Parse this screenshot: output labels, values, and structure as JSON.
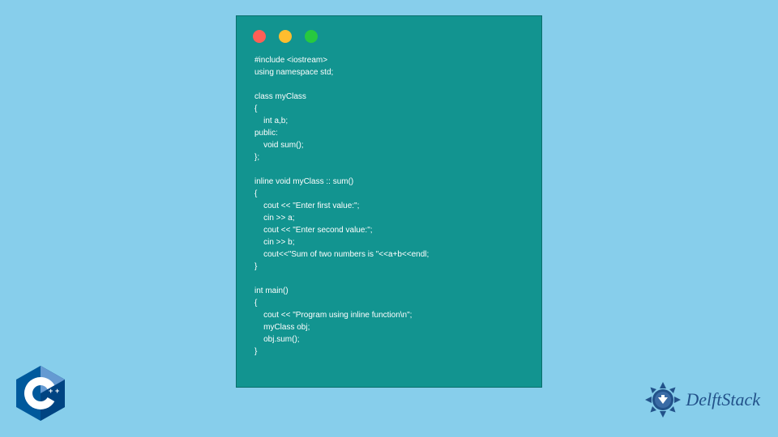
{
  "code": {
    "lines": [
      "#include <iostream>",
      "using namespace std;",
      "",
      "class myClass",
      "{",
      "    int a,b;",
      "public:",
      "    void sum();",
      "};",
      "",
      "inline void myClass :: sum()",
      "{",
      "    cout << \"Enter first value:\";",
      "    cin >> a;",
      "    cout << \"Enter second value:\";",
      "    cin >> b;",
      "    cout<<\"Sum of two numbers is \"<<a+b<<endl;",
      "}",
      "",
      "int main()",
      "{",
      "    cout << \"Program using inline function\\n\";",
      "    myClass obj;",
      "    obj.sum();",
      "}"
    ]
  },
  "branding": {
    "cpp_label": "C++",
    "site_name": "DelftStack"
  },
  "colors": {
    "background": "#87ceeb",
    "code_window": "#129490",
    "dot_red": "#ff5f56",
    "dot_yellow": "#ffbd2e",
    "dot_green": "#27c93f",
    "cpp_blue": "#00599c",
    "delft_blue": "#22528a"
  }
}
